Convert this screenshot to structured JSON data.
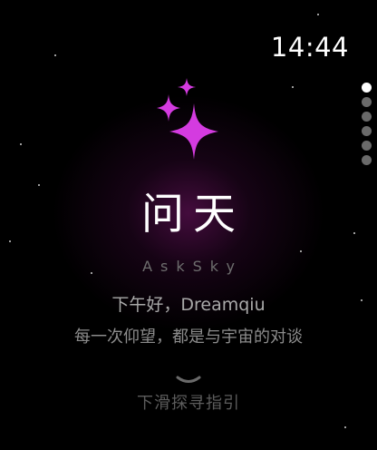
{
  "status_bar": {
    "time": "14:44"
  },
  "page_indicator": {
    "total": 6,
    "active_index": 0
  },
  "hero": {
    "icon": "sparkles-icon",
    "icon_color": "#d43be0",
    "title": "问天",
    "subtitle": "AskSky"
  },
  "greeting": {
    "text": "下午好，Dreamqiu",
    "tagline": "每一次仰望，都是与宇宙的对谈"
  },
  "scroll_hint": {
    "icon": "chevron-down-icon",
    "label": "下滑探寻指引"
  },
  "colors": {
    "background": "#000000",
    "accent": "#d43be0",
    "text_primary": "#ffffff",
    "text_secondary": "#a9a9a9"
  }
}
